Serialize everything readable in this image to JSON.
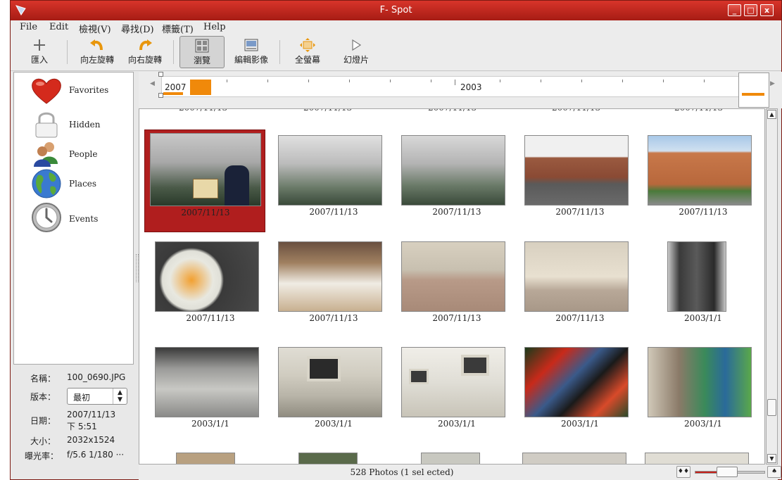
{
  "window": {
    "title": "F- Spot",
    "min": "_",
    "max": "□",
    "close": "x"
  },
  "menubar": [
    "File",
    "Edit",
    "檢視(V)",
    "尋找(D)",
    "標籤(T)",
    "Help"
  ],
  "toolbar": {
    "import": "匯入",
    "rotate_left": "向左旋轉",
    "rotate_right": "向右旋轉",
    "browse": "瀏覽",
    "edit_image": "編輯影像",
    "fullscreen": "全螢幕",
    "slideshow": "幻燈片"
  },
  "sidebar": [
    {
      "label": "Favorites",
      "icon": "heart-icon"
    },
    {
      "label": "Hidden",
      "icon": "lock-icon"
    },
    {
      "label": "People",
      "icon": "people-icon"
    },
    {
      "label": "Places",
      "icon": "globe-icon"
    },
    {
      "label": "Events",
      "icon": "clock-icon"
    }
  ],
  "info": {
    "name_label": "名稱：",
    "name_value": "100_0690.JPG",
    "version_label": "版本：",
    "version_value": "最初",
    "date_label": "日期：",
    "date_value_1": "2007/11/13",
    "date_value_2": "下 5:51",
    "size_label": "大小：",
    "size_value": "2032x1524",
    "exposure_label": "曝光率：",
    "exposure_value": "f/5.6 1/180 ···"
  },
  "timeline": {
    "start_label": "2007",
    "mid_label": "2003"
  },
  "photos": [
    {
      "date": "2007/11/13",
      "selected": true
    },
    {
      "date": "2007/11/13",
      "selected": false
    },
    {
      "date": "2007/11/13",
      "selected": false
    },
    {
      "date": "2007/11/13",
      "selected": false
    },
    {
      "date": "2007/11/13",
      "selected": false
    },
    {
      "date": "2007/11/13",
      "selected": false
    },
    {
      "date": "2007/11/13",
      "selected": false
    },
    {
      "date": "2007/11/13",
      "selected": false
    },
    {
      "date": "2007/11/13",
      "selected": false
    },
    {
      "date": "2003/1/1",
      "selected": false
    },
    {
      "date": "2003/1/1",
      "selected": false
    },
    {
      "date": "2003/1/1",
      "selected": false
    },
    {
      "date": "2003/1/1",
      "selected": false
    },
    {
      "date": "2003/1/1",
      "selected": false
    },
    {
      "date": "2003/1/1",
      "selected": false
    }
  ],
  "status": {
    "text": "528 Photos (1 sel ected)"
  },
  "colors": {
    "accent": "#b01e1e",
    "timeline_bar": "#f0890a"
  }
}
